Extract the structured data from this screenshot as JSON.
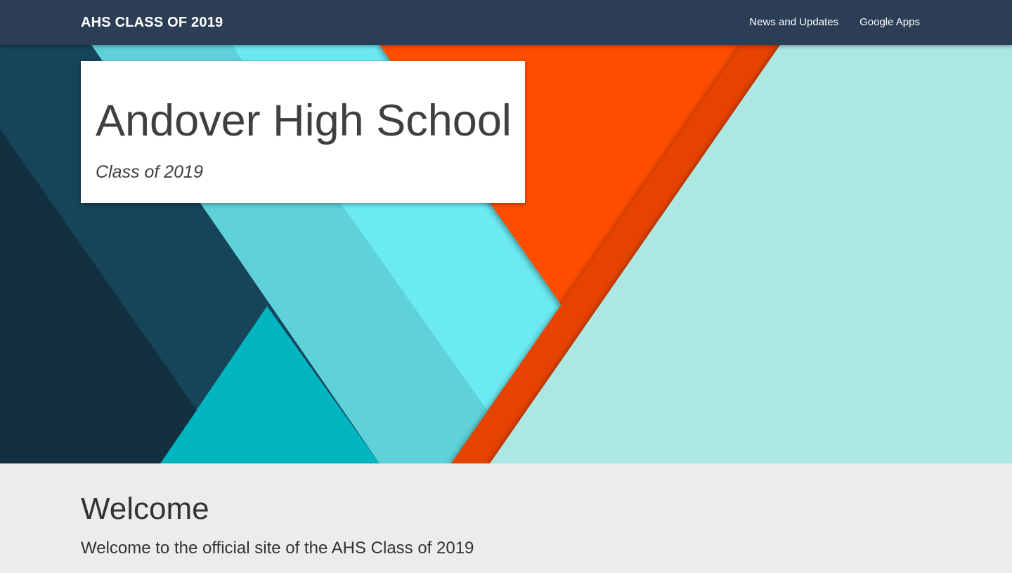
{
  "navbar": {
    "brand": "AHS CLASS OF 2019",
    "links": [
      {
        "label": "News and Updates"
      },
      {
        "label": "Google Apps"
      }
    ],
    "background_color": "#2c3e55"
  },
  "hero": {
    "title": "Andover High School",
    "subtitle": "Class of 2019",
    "colors": {
      "dark_navy": "#12303f",
      "navy": "#164459",
      "teal": "#00b5bf",
      "medium_cyan": "#5ed1d9",
      "bright_cyan": "#6beaf2",
      "orange": "#ff4e00",
      "dark_orange": "#e64300",
      "pale_mint": "#ace8e1"
    }
  },
  "welcome": {
    "heading": "Welcome",
    "text": "Welcome to the official site of the AHS Class of 2019"
  }
}
